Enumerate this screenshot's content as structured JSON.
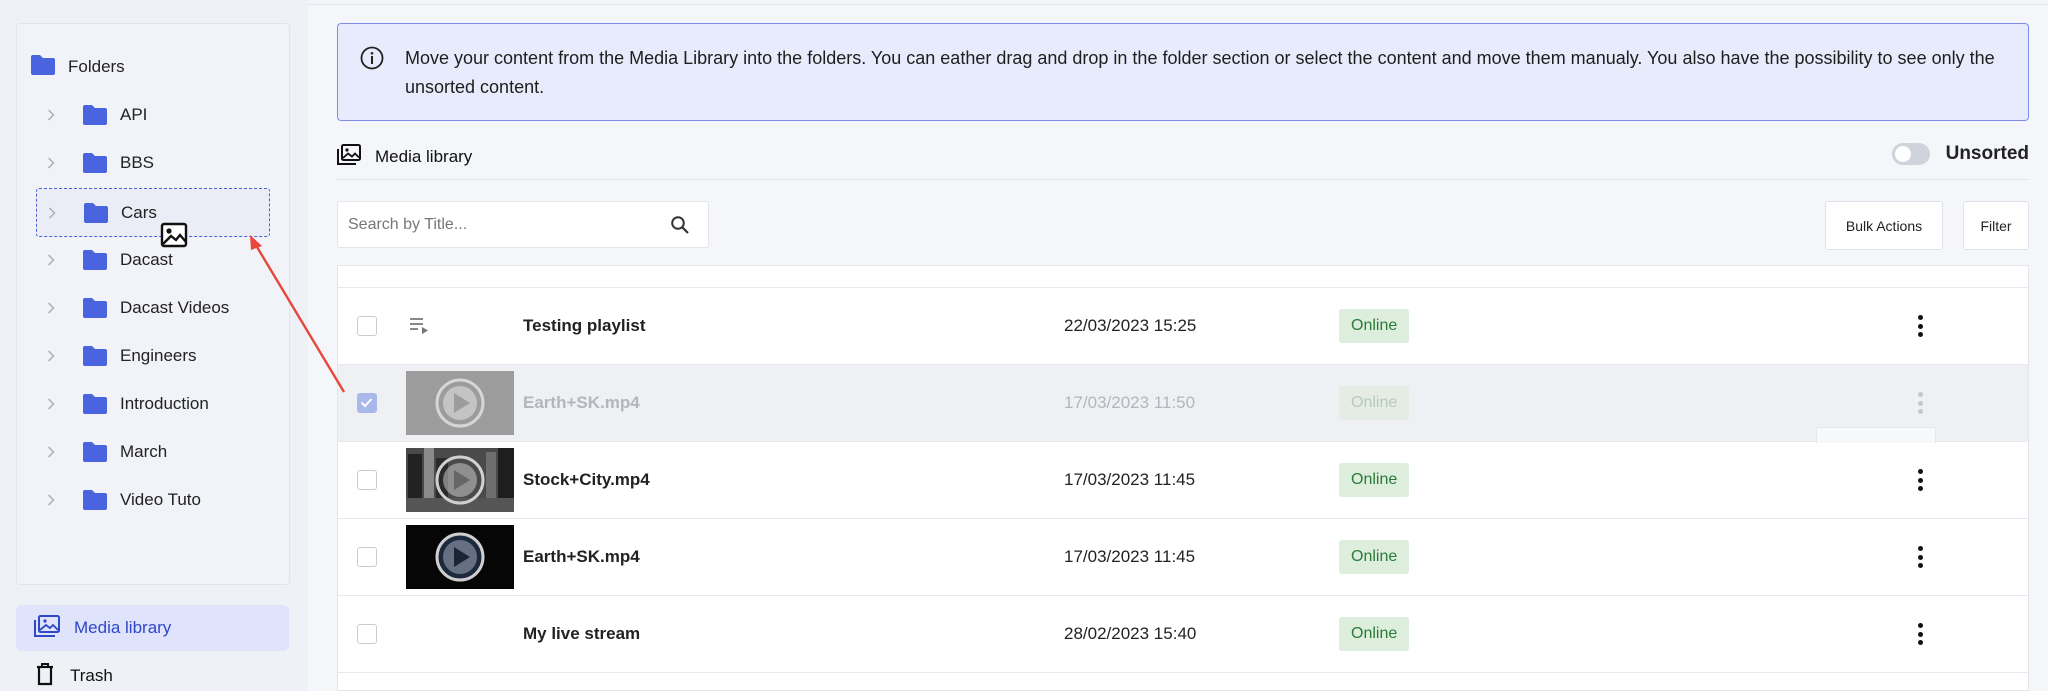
{
  "sidebar": {
    "root_label": "Folders",
    "folders": [
      {
        "label": "API"
      },
      {
        "label": "BBS"
      },
      {
        "label": "Cars"
      },
      {
        "label": "Dacast"
      },
      {
        "label": "Dacast Videos"
      },
      {
        "label": "Engineers"
      },
      {
        "label": "Introduction"
      },
      {
        "label": "March"
      },
      {
        "label": "Video Tuto"
      }
    ],
    "nav": {
      "media_library": "Media library",
      "trash": "Trash"
    }
  },
  "info": {
    "text": "Move your content from the Media Library into the folders. You can eather drag and drop in the folder section or select the content and move them manualy. You also have the possibility to see only the unsorted content."
  },
  "library": {
    "title": "Media library",
    "unsorted_label": "Unsorted",
    "unsorted_on": false
  },
  "toolbar": {
    "search_placeholder": "Search by Title...",
    "bulk_actions": "Bulk Actions",
    "filter": "Filter"
  },
  "table": {
    "rows": [
      {
        "name": "Testing playlist",
        "date": "22/03/2023 15:25",
        "status": "Online",
        "type": "playlist",
        "checked": false
      },
      {
        "name": "Earth+SK.mp4",
        "date": "17/03/2023 11:50",
        "status": "Online",
        "type": "video-grey",
        "checked": true
      },
      {
        "name": "Stock+City.mp4",
        "date": "17/03/2023 11:45",
        "status": "Online",
        "type": "video-city",
        "checked": false
      },
      {
        "name": "Earth+SK.mp4",
        "date": "17/03/2023 11:45",
        "status": "Online",
        "type": "video-earth",
        "checked": false
      },
      {
        "name": "My live stream",
        "date": "28/02/2023 15:40",
        "status": "Online",
        "type": "live",
        "checked": false
      }
    ]
  },
  "colors": {
    "accent": "#2f47c9",
    "folder_icon": "#4a64e0",
    "online_bg": "#ddeedd",
    "online_text": "#2b7a3a"
  }
}
